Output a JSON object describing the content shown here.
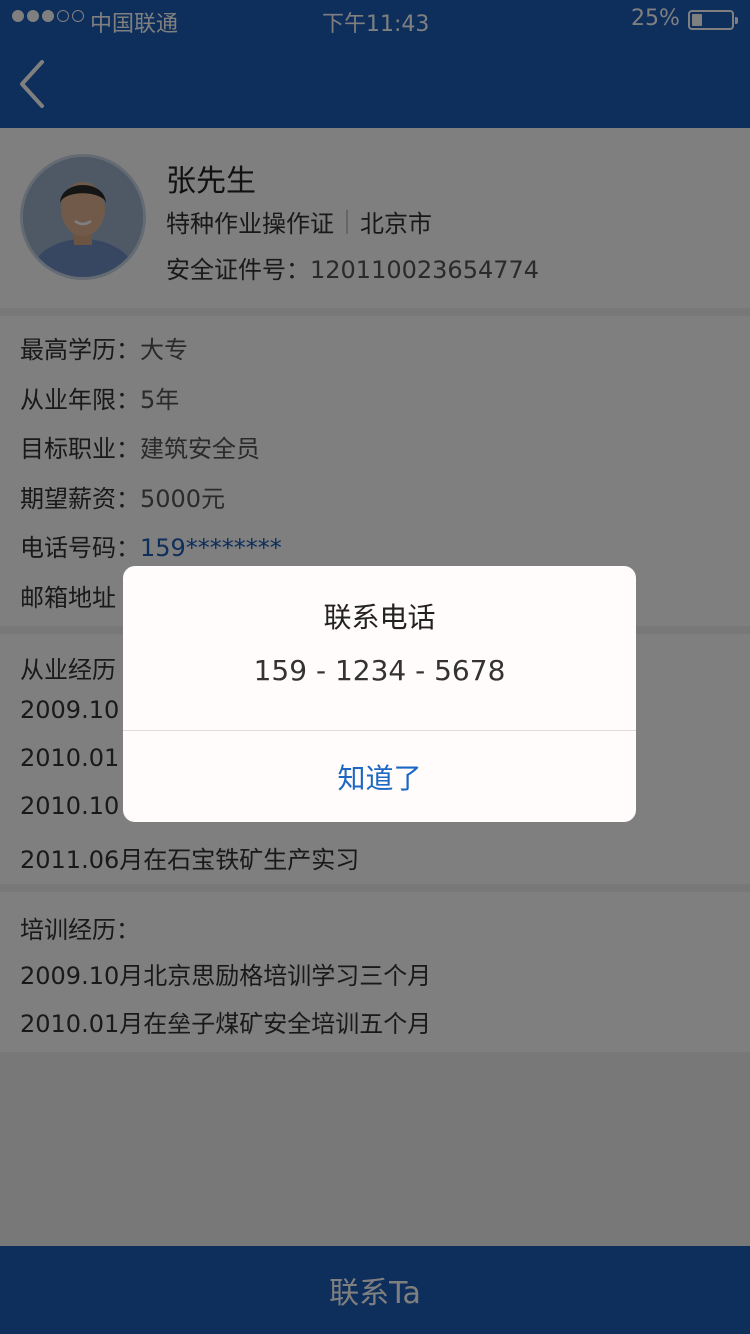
{
  "status_bar": {
    "carrier": "中国联通",
    "time": "下午11:43",
    "battery_percent": "25%",
    "battery_level": 0.25,
    "signal_bars_filled": 3,
    "signal_bars_total": 5
  },
  "nav": {
    "back_icon": "chevron-left-icon"
  },
  "profile": {
    "name": "张先生",
    "certificate_type": "特种作业操作证",
    "city": "北京市",
    "cert_label": "安全证件号：",
    "cert_number": "120110023654774"
  },
  "info": {
    "education_label": "最高学历：",
    "education_value": "大专",
    "years_label": "从业年限：",
    "years_value": "5年",
    "target_label": "目标职业：",
    "target_value": "建筑安全员",
    "salary_label": "期望薪资：",
    "salary_value": "5000元",
    "phone_label": "电话号码：",
    "phone_value": "159********",
    "email_label": "邮箱地址"
  },
  "career": {
    "heading": "从业经历",
    "items": [
      "2009.10",
      "2010.01",
      "2010.10",
      "2011.06月在石宝铁矿生产实习"
    ]
  },
  "training": {
    "heading": "培训经历：",
    "items": [
      "2009.10月北京思励格培训学习三个月",
      "2010.01月在垒子煤矿安全培训五个月"
    ]
  },
  "footer": {
    "contact_label": "联系Ta"
  },
  "dialog": {
    "title": "联系电话",
    "phone": "159 - 1234 - 5678",
    "ok_label": "知道了"
  },
  "colors": {
    "primary": "#1d5db8",
    "link": "#1d67c4"
  }
}
